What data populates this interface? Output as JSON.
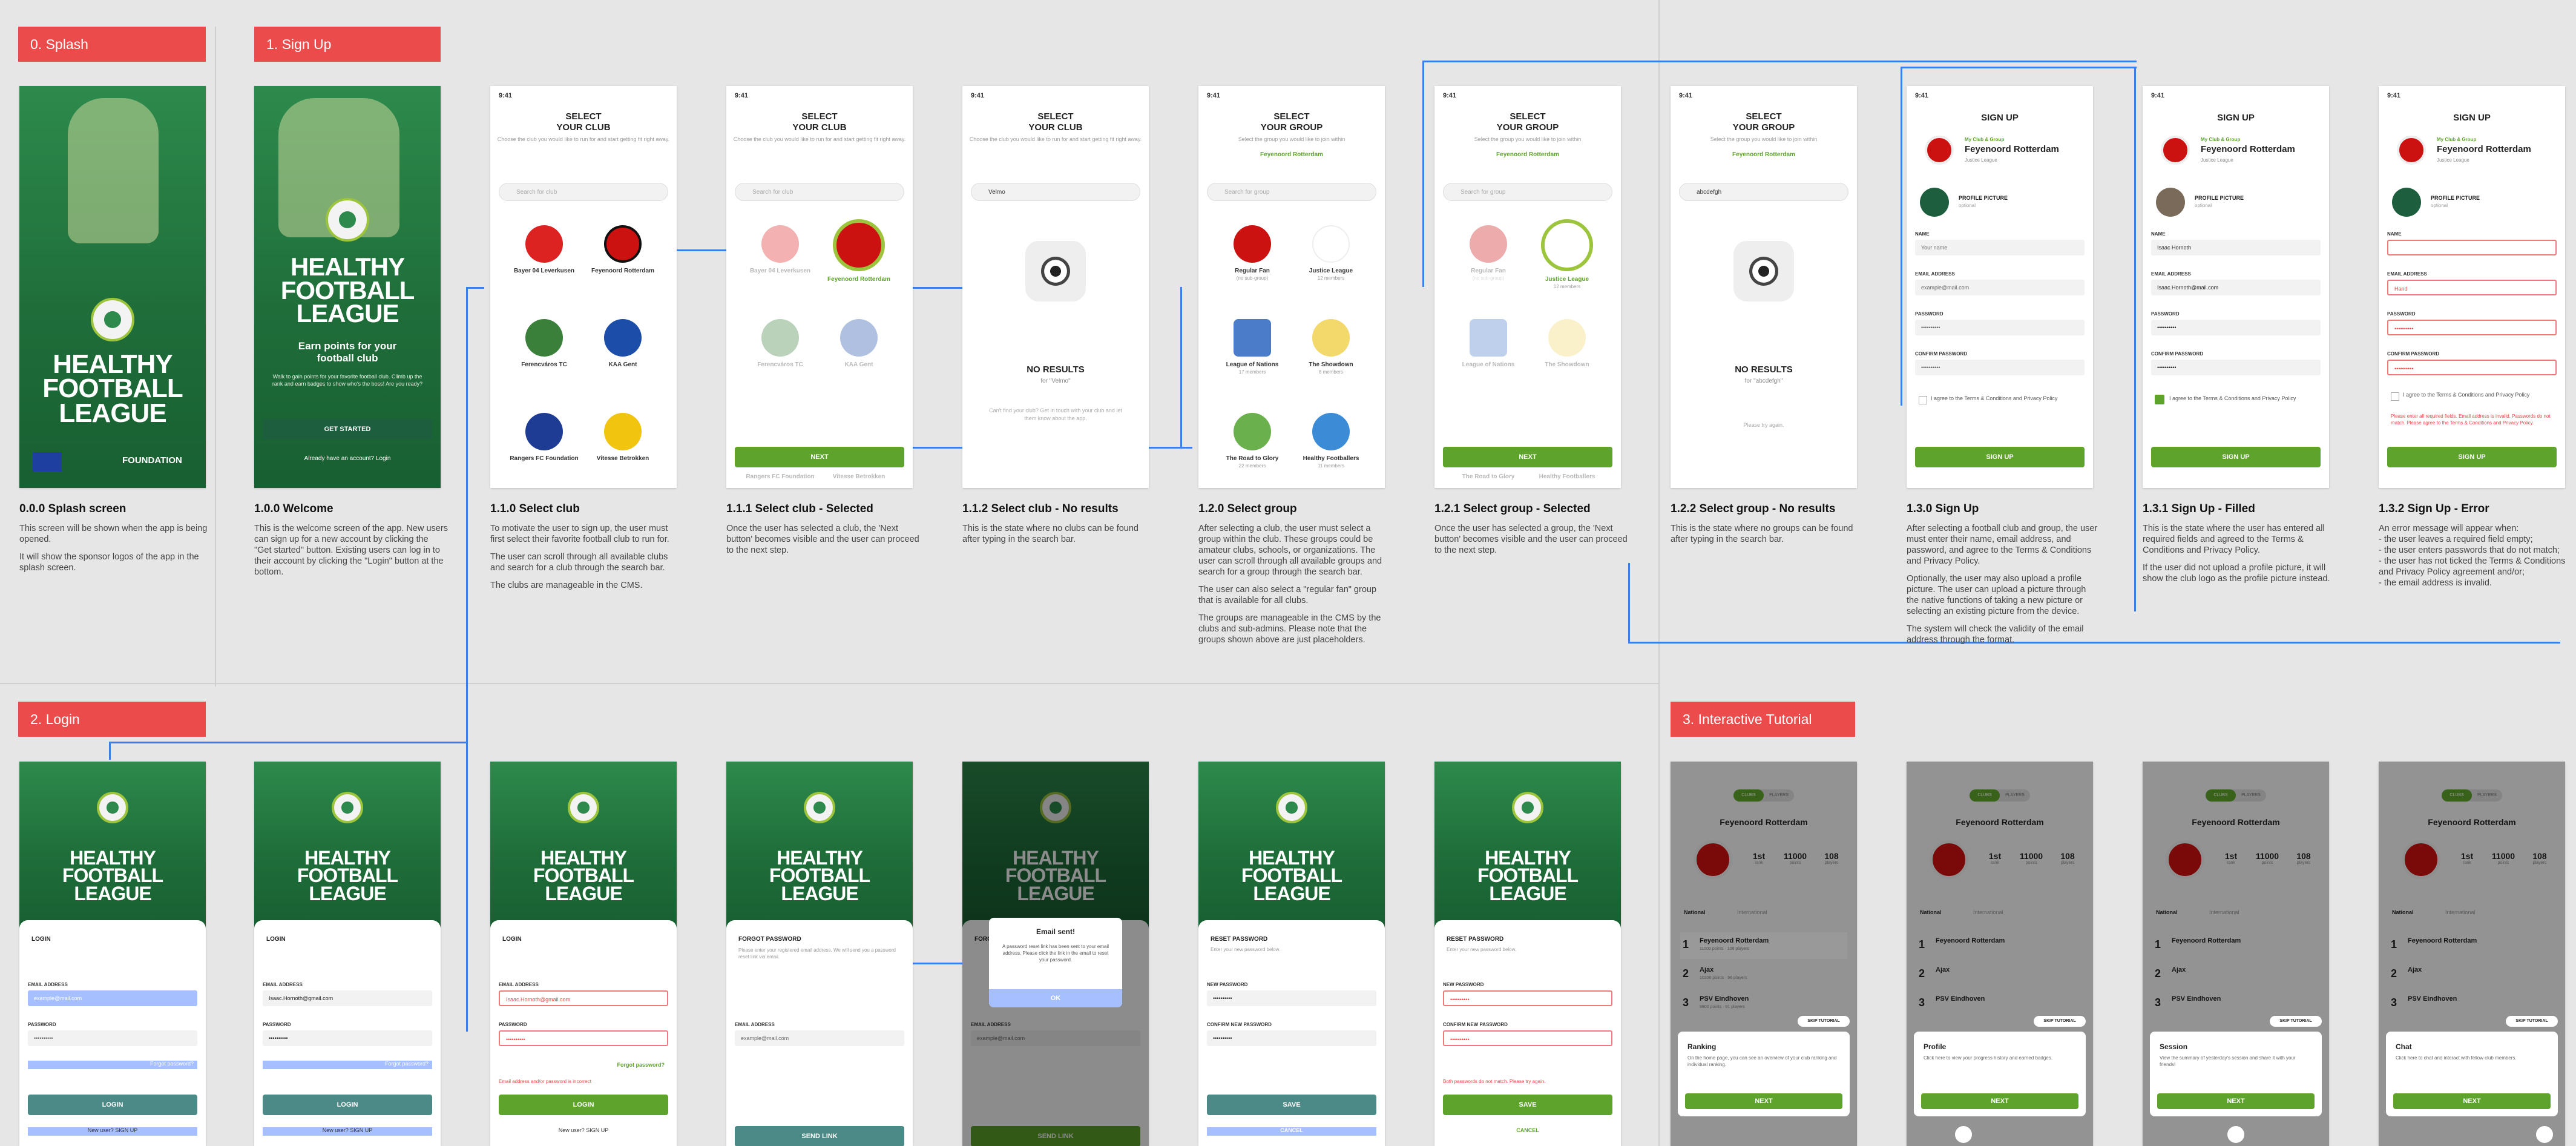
{
  "sections": {
    "splash": "0. Splash",
    "signup": "1. Sign Up",
    "login": "2. Login",
    "tutorial": "3. Interactive Tutorial"
  },
  "colors": {
    "section_tag": "#ec4b4b",
    "green": "#5ea32b",
    "dark_green": "#1c5e3e",
    "connector": "#3d7de6",
    "error": "#f07a7a"
  },
  "status_time": "9:41",
  "brand": {
    "line1": "HEALTHY",
    "line2": "FOOTBALL",
    "line3": "LEAGUE"
  },
  "splash_screen": {
    "foundation": "FOUNDATION"
  },
  "welcome_screen": {
    "tagline": "Earn points for your football club",
    "body": "Walk to gain points for your favorite football club. Climb up the rank and earn badges to show who's the boss! Are you ready?",
    "cta": "GET STARTED",
    "login_prompt": "Already have an account? Login"
  },
  "select_club": {
    "title1": "SELECT",
    "title2": "YOUR CLUB",
    "subtitle": "Choose the club you would like to run for and start getting fit right away.",
    "search_placeholder": "Search for club",
    "typed": "Velmo",
    "clubs": [
      "Bayer 04 Leverkusen",
      "Feyenoord Rotterdam",
      "Ferencváros TC",
      "KAA Gent",
      "Rangers FC Foundation",
      "Vitesse Betrokken"
    ],
    "next": "NEXT",
    "no_results": "NO RESULTS",
    "no_results_for": "for \"Velmo\"",
    "no_results_help": "Can't find your club? Get in touch with your club and let them know about the app."
  },
  "select_group": {
    "title1": "SELECT",
    "title2": "YOUR GROUP",
    "subtitle": "Select the group you would like to join within",
    "club": "Feyenoord Rotterdam",
    "search_placeholder": "Search for group",
    "typed": "abcdefgh",
    "groups": [
      {
        "name": "Regular Fan",
        "sub": "(no sub-group)"
      },
      {
        "name": "Justice League",
        "sub": "12 members"
      },
      {
        "name": "League of Nations",
        "sub": "17 members"
      },
      {
        "name": "The Showdown",
        "sub": "8 members"
      },
      {
        "name": "The Road to Glory",
        "sub": "22 members"
      },
      {
        "name": "Healthy Footballers",
        "sub": "11 members"
      }
    ],
    "no_results": "NO RESULTS",
    "no_results_for": "for \"abcdefgh\"",
    "no_results_help": "Please try again."
  },
  "signup_form": {
    "title": "SIGN UP",
    "club_group_label": "My Club & Group",
    "club": "Feyenoord Rotterdam",
    "group": "Justice League",
    "profile_picture": "PROFILE PICTURE",
    "optional": "optional",
    "name_label": "NAME",
    "email_label": "EMAIL ADDRESS",
    "password_label": "PASSWORD",
    "confirm_label": "CONFIRM PASSWORD",
    "name_ph": "Your name",
    "email_ph": "example@mail.com",
    "password_dots": "••••••••••",
    "filled_name": "Isaac Hornoth",
    "filled_email": "Isaac.Hornoth@mail.com",
    "error_email": "Hand",
    "agree": "I agree to the Terms & Conditions and Privacy Policy",
    "error_text": "Please enter all required fields. Email address is invalid. Passwords do not match. Please agree to the Terms & Conditions and Privacy Policy.",
    "cta": "SIGN UP"
  },
  "login_form": {
    "title": "LOGIN",
    "email_label": "EMAIL ADDRESS",
    "password_label": "PASSWORD",
    "email_ph": "example@mail.com",
    "email_val": "Isaac.Hornoth@gmail.com",
    "password_dots": "••••••••••",
    "forgot": "Forgot password?",
    "error": "Email address and/or password is incorrect",
    "cta": "LOGIN",
    "new_user": "New user? SIGN UP"
  },
  "forgot_form": {
    "title": "FORGOT PASSWORD",
    "body": "Please enter your registered email address. We will send you a password reset link via email.",
    "email_label": "EMAIL ADDRESS",
    "email_ph": "example@mail.com",
    "cta": "SEND LINK",
    "modal_title": "Email sent!",
    "modal_body": "A password reset link has been sent to your email address. Please click the link in the email to reset your password.",
    "modal_ok": "OK"
  },
  "reset_form": {
    "title": "RESET PASSWORD",
    "body": "Enter your new password below.",
    "new_label": "NEW PASSWORD",
    "confirm_label": "CONFIRM NEW PASSWORD",
    "password_dots": "••••••••••",
    "error": "Both passwords do not match. Please try again.",
    "cta": "SAVE",
    "cancel": "CANCEL"
  },
  "tutorial": {
    "tabs": [
      "CLUBS",
      "PLAYERS"
    ],
    "club": "Feyenoord Rotterdam",
    "stats": [
      {
        "value": "1st",
        "label": "rank"
      },
      {
        "value": "11000",
        "label": "points"
      },
      {
        "value": "108",
        "label": "players"
      }
    ],
    "subtabs": [
      "National",
      "International"
    ],
    "rows": [
      {
        "rank": "1",
        "name": "Feyenoord Rotterdam",
        "sub": "11000 points · 108 players"
      },
      {
        "rank": "2",
        "name": "Ajax",
        "sub": "10200 points · 96 players"
      },
      {
        "rank": "3",
        "name": "PSV Eindhoven",
        "sub": "9800 points · 91 players"
      }
    ],
    "skip": "SKIP TUTORIAL",
    "next": "NEXT",
    "cards": [
      {
        "title": "Ranking",
        "body": "On the home page, you can see an overview of your club ranking and individual ranking."
      },
      {
        "title": "Profile",
        "body": "Click here to view your progress history and earned badges."
      },
      {
        "title": "Session",
        "body": "View the summary of yesterday's session and share it with your friends!"
      },
      {
        "title": "Chat",
        "body": "Click here to chat and interact with fellow club members."
      }
    ]
  },
  "captions": [
    {
      "title": "0.0.0 Splash screen",
      "paras": [
        "This screen will be shown when the app is being opened.",
        "It will show the sponsor logos of the app in the splash screen."
      ]
    },
    {
      "title": "1.0.0 Welcome",
      "paras": [
        "This is the welcome screen of the app. New users can sign up for a new account by clicking the \"Get started\" button. Existing users can log in to their account by clicking the \"Login\" button at the bottom."
      ]
    },
    {
      "title": "1.1.0 Select club",
      "paras": [
        "To motivate the user to sign up, the user must first select their favorite football club to run for.",
        "The user can scroll through all available clubs and search for a club through the search bar.",
        "The clubs are manageable in the CMS."
      ]
    },
    {
      "title": "1.1.1 Select club - Selected",
      "paras": [
        "Once the user has selected a club, the 'Next button' becomes visible and the user can proceed to the next step."
      ]
    },
    {
      "title": "1.1.2 Select club - No results",
      "paras": [
        "This is the state where no clubs can be found after typing in the search bar."
      ]
    },
    {
      "title": "1.2.0 Select group",
      "paras": [
        "After selecting a club, the user must select a group within the club. These groups could be amateur clubs, schools, or organizations. The user can scroll through all available groups and search for a group through the search bar.",
        "The user can also select a \"regular fan\" group that is available for all clubs.",
        "The groups are manageable in the CMS by the clubs and sub-admins. Please note that the groups shown above are just placeholders."
      ]
    },
    {
      "title": "1.2.1 Select group - Selected",
      "paras": [
        "Once the user has selected a group, the 'Next button' becomes visible and the user can proceed to the next step."
      ]
    },
    {
      "title": "1.2.2 Select group - No results",
      "paras": [
        "This is the state where no groups can be found after typing in the search bar."
      ]
    },
    {
      "title": "1.3.0 Sign Up",
      "paras": [
        "After selecting a football club and group, the user must enter their name, email address, and password, and agree to the Terms & Conditions and Privacy Policy.",
        "Optionally, the user may also upload a profile picture. The user can upload a picture through the native functions of taking a new picture or selecting an existing picture from the device.",
        "The system will check the validity of the email address through the format."
      ]
    },
    {
      "title": "1.3.1 Sign Up - Filled",
      "paras": [
        "This is the state where the user has entered all required fields and agreed to the Terms & Conditions and Privacy Policy.",
        "If the user did not upload a profile picture, it will show the club logo as the profile picture instead."
      ]
    },
    {
      "title": "1.3.2 Sign Up - Error",
      "paras": [
        "An error message will appear when:",
        "- the user leaves a required field empty;",
        "- the user enters passwords that do not match;",
        "- the user has not ticked the Terms & Conditions and Privacy Policy agreement and/or;",
        "- the email address is invalid."
      ]
    }
  ]
}
